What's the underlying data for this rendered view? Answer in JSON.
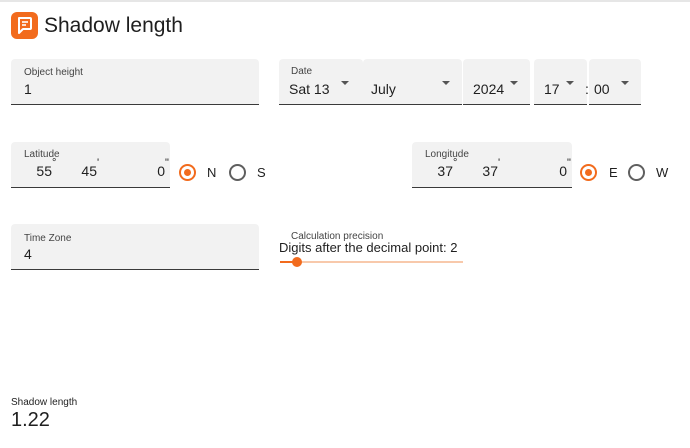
{
  "app": {
    "title": "Shadow length",
    "icon": "app-logo-icon",
    "accent": "#f26b1d"
  },
  "object_height": {
    "label": "Object height",
    "value": "1"
  },
  "date": {
    "label": "Date",
    "day": "Sat 13",
    "month": "July",
    "year": "2024",
    "hour": "17",
    "separator": ":",
    "minute": "00"
  },
  "latitude": {
    "label": "Latitude",
    "deg": "55",
    "min": "45",
    "sec": "0",
    "options": [
      "N",
      "S"
    ],
    "selected": "N"
  },
  "longitude": {
    "label": "Longitude",
    "deg": "37",
    "min": "37",
    "sec": "0",
    "options": [
      "E",
      "W"
    ],
    "selected": "E"
  },
  "timezone": {
    "label": "Time Zone",
    "value": "4"
  },
  "precision": {
    "label": "Calculation precision",
    "text": "Digits after the decimal point: 2",
    "value": 2
  },
  "result": {
    "label": "Shadow length",
    "value": "1.22"
  }
}
